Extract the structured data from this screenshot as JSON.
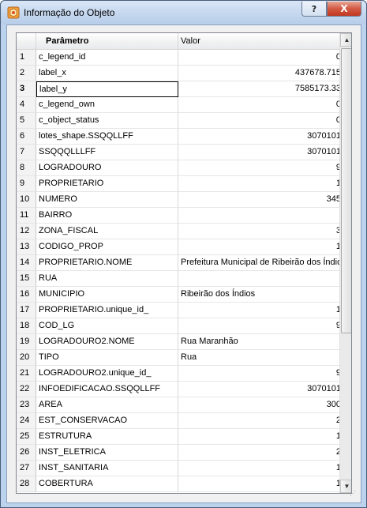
{
  "window": {
    "title": "Informação do Objeto",
    "help_label": "?",
    "close_label": "X"
  },
  "table": {
    "columns": [
      "Parâmetro",
      "Valor"
    ],
    "current_row": 3,
    "rows": [
      {
        "n": "1",
        "param": "c_legend_id",
        "value": "0",
        "align": "right"
      },
      {
        "n": "2",
        "param": "label_x",
        "value": "437678.715",
        "align": "right"
      },
      {
        "n": "3",
        "param": "label_y",
        "value": "7585173.33",
        "align": "right"
      },
      {
        "n": "4",
        "param": "c_legend_own",
        "value": "0",
        "align": "right"
      },
      {
        "n": "5",
        "param": "c_object_status",
        "value": "0",
        "align": "right"
      },
      {
        "n": "6",
        "param": "lotes_shape.SSQQLLFF",
        "value": "3070101",
        "align": "right"
      },
      {
        "n": "7",
        "param": "SSQQQLLLFF",
        "value": "3070101",
        "align": "right"
      },
      {
        "n": "8",
        "param": "LOGRADOURO",
        "value": "9",
        "align": "right"
      },
      {
        "n": "9",
        "param": "PROPRIETARIO",
        "value": "1",
        "align": "right"
      },
      {
        "n": "10",
        "param": "NUMERO",
        "value": "345",
        "align": "right"
      },
      {
        "n": "11",
        "param": "BAIRRO",
        "value": "",
        "align": "left"
      },
      {
        "n": "12",
        "param": "ZONA_FISCAL",
        "value": "3",
        "align": "right"
      },
      {
        "n": "13",
        "param": "CODIGO_PROP",
        "value": "1",
        "align": "right"
      },
      {
        "n": "14",
        "param": "PROPRIETARIO.NOME",
        "value": "Prefeitura Municipal de Ribeirão dos Índios",
        "align": "left"
      },
      {
        "n": "15",
        "param": "RUA",
        "value": "",
        "align": "left"
      },
      {
        "n": "16",
        "param": "MUNICIPIO",
        "value": "Ribeirão dos Índios",
        "align": "left"
      },
      {
        "n": "17",
        "param": "PROPRIETARIO.unique_id_",
        "value": "1",
        "align": "right"
      },
      {
        "n": "18",
        "param": "COD_LG",
        "value": "9",
        "align": "right"
      },
      {
        "n": "19",
        "param": "LOGRADOURO2.NOME",
        "value": "Rua Maranhão",
        "align": "left"
      },
      {
        "n": "20",
        "param": "TIPO",
        "value": "Rua",
        "align": "left"
      },
      {
        "n": "21",
        "param": "LOGRADOURO2.unique_id_",
        "value": "9",
        "align": "right"
      },
      {
        "n": "22",
        "param": "INFOEDIFICACAO.SSQQLLFF",
        "value": "3070101",
        "align": "right"
      },
      {
        "n": "23",
        "param": "AREA",
        "value": "300",
        "align": "right"
      },
      {
        "n": "24",
        "param": "EST_CONSERVACAO",
        "value": "2",
        "align": "right"
      },
      {
        "n": "25",
        "param": "ESTRUTURA",
        "value": "1",
        "align": "right"
      },
      {
        "n": "26",
        "param": "INST_ELETRICA",
        "value": "2",
        "align": "right"
      },
      {
        "n": "27",
        "param": "INST_SANITARIA",
        "value": "1",
        "align": "right"
      },
      {
        "n": "28",
        "param": "COBERTURA",
        "value": "1",
        "align": "right"
      }
    ]
  },
  "icons": {
    "app": "terralib-app-icon",
    "scroll_up": "scroll-up-arrow-icon",
    "scroll_down": "scroll-down-arrow-icon"
  }
}
